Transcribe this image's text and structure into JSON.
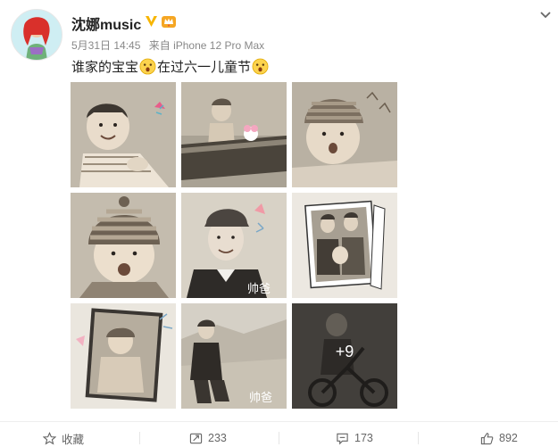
{
  "post": {
    "username": "沈娜music",
    "timestamp": "5月31日 14:45",
    "source": "来自 iPhone 12 Pro Max",
    "content_part1": "谁家的宝宝",
    "content_part2": "在过六一儿童节",
    "photos": [
      {
        "caption": "",
        "scene": "baby-smiling"
      },
      {
        "caption": "",
        "scene": "baby-in-tub"
      },
      {
        "caption": "",
        "scene": "baby-knit-hat"
      },
      {
        "caption": "",
        "scene": "baby-striped-hat"
      },
      {
        "caption": "帅爸",
        "scene": "young-man-cap"
      },
      {
        "caption": "",
        "scene": "family-portrait"
      },
      {
        "caption": "",
        "scene": "framed-baby"
      },
      {
        "caption": "帅爸",
        "scene": "man-seated-outdoors"
      },
      {
        "caption": "",
        "scene": "child-tricycle",
        "more": "+9"
      }
    ]
  },
  "actions": {
    "favorite_label": "收藏",
    "repost_count": "233",
    "comment_count": "173",
    "like_count": "892"
  },
  "icons": {
    "verified": "verified-badge-icon",
    "vip": "vip-crown-icon",
    "caret": "chevron-down-icon",
    "favorite": "star-icon",
    "repost": "repost-icon",
    "comment": "comment-icon",
    "like": "thumbs-up-icon"
  },
  "colors": {
    "verified": "#f7b500",
    "username": "#222222",
    "meta": "#888888",
    "action_text": "#666666"
  }
}
